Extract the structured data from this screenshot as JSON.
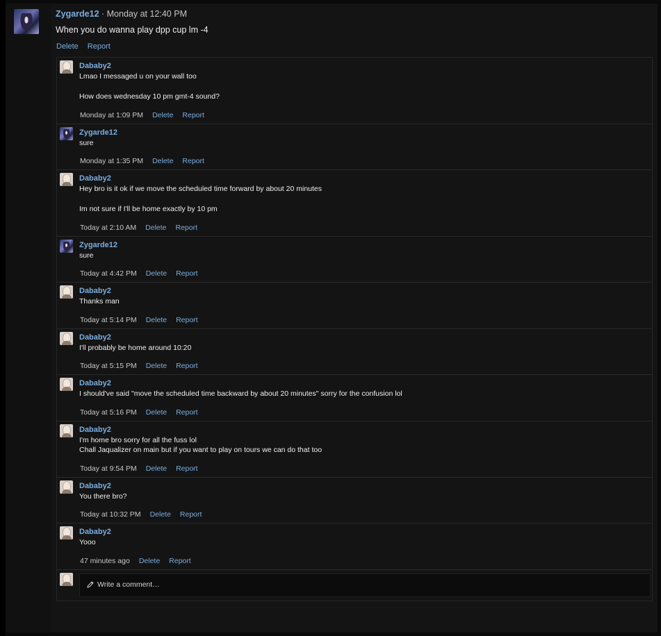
{
  "post": {
    "author": "Zygarde12",
    "timestamp": " · Monday at 12:40 PM",
    "body": "When you do wanna play dpp cup lm -4",
    "delete_label": "Delete",
    "report_label": "Report"
  },
  "comments": [
    {
      "author": "Dababy2",
      "avatar": "dababy-avatar",
      "lines": [
        "Lmao I messaged u on your wall too",
        "",
        "How does wednesday 10 pm gmt-4 sound?"
      ],
      "time": "Monday at 1:09 PM",
      "delete_label": "Delete",
      "report_label": "Report"
    },
    {
      "author": "Zygarde12",
      "avatar": "zygarde-avatar",
      "lines": [
        "sure"
      ],
      "time": "Monday at 1:35 PM",
      "delete_label": "Delete",
      "report_label": "Report"
    },
    {
      "author": "Dababy2",
      "avatar": "dababy-avatar",
      "lines": [
        "Hey bro is it ok if we move the scheduled time forward by about 20 minutes",
        "",
        "Im not sure if I'll be home exactly by 10 pm"
      ],
      "time": "Today at 2:10 AM",
      "delete_label": "Delete",
      "report_label": "Report"
    },
    {
      "author": "Zygarde12",
      "avatar": "zygarde-avatar",
      "lines": [
        "sure"
      ],
      "time": "Today at 4:42 PM",
      "delete_label": "Delete",
      "report_label": "Report"
    },
    {
      "author": "Dababy2",
      "avatar": "dababy-avatar",
      "lines": [
        "Thanks man"
      ],
      "time": "Today at 5:14 PM",
      "delete_label": "Delete",
      "report_label": "Report"
    },
    {
      "author": "Dababy2",
      "avatar": "dababy-avatar",
      "lines": [
        "I'll probably be home around 10:20"
      ],
      "time": "Today at 5:15 PM",
      "delete_label": "Delete",
      "report_label": "Report"
    },
    {
      "author": "Dababy2",
      "avatar": "dababy-avatar",
      "lines": [
        "I should've said \"move the scheduled time backward by about 20 minutes\" sorry for the confusion lol"
      ],
      "time": "Today at 5:16 PM",
      "delete_label": "Delete",
      "report_label": "Report"
    },
    {
      "author": "Dababy2",
      "avatar": "dababy-avatar",
      "lines": [
        "I'm home bro sorry for all the fuss lol",
        "Chall Jaqualizer on main but if you want to play on tours we can do that too"
      ],
      "time": "Today at 9:54 PM",
      "delete_label": "Delete",
      "report_label": "Report"
    },
    {
      "author": "Dababy2",
      "avatar": "dababy-avatar",
      "lines": [
        "You there bro?"
      ],
      "time": "Today at 10:32 PM",
      "delete_label": "Delete",
      "report_label": "Report"
    },
    {
      "author": "Dababy2",
      "avatar": "dababy-avatar",
      "lines": [
        "Yooo"
      ],
      "time": "47 minutes ago",
      "delete_label": "Delete",
      "report_label": "Report"
    }
  ],
  "composer": {
    "placeholder": "Write a comment…",
    "icon": "pencil-icon",
    "avatar": "dababy-avatar"
  }
}
